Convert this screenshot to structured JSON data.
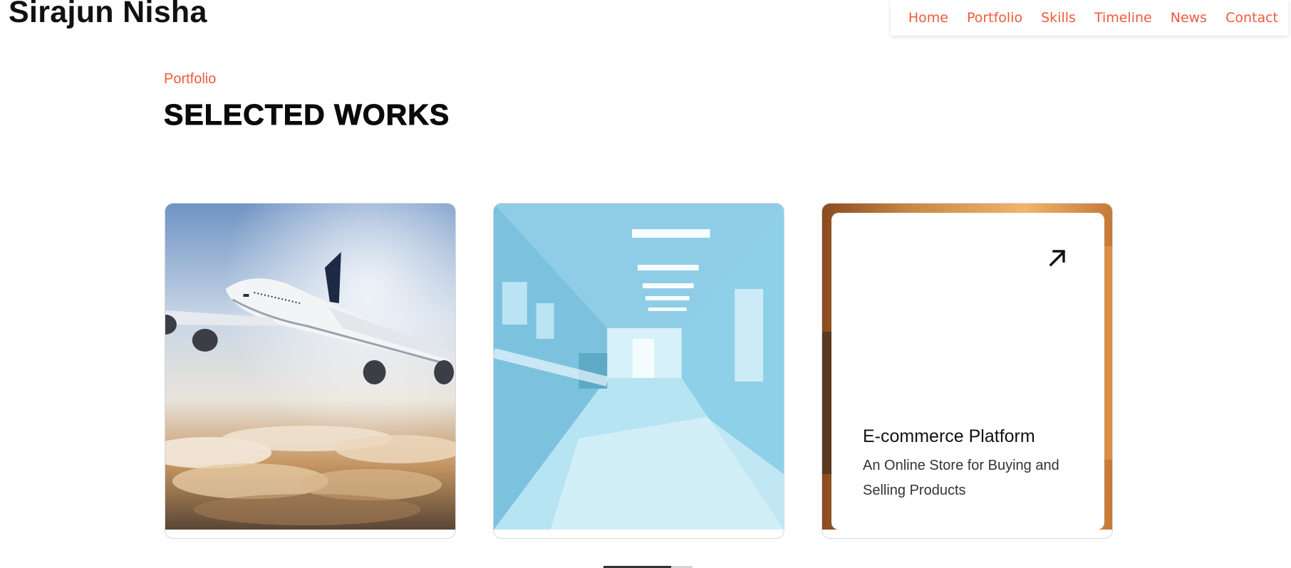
{
  "brand": "Sirajun Nisha",
  "nav": {
    "items": [
      "Home",
      "Portfolio",
      "Skills",
      "Timeline",
      "News",
      "Contact"
    ]
  },
  "colors": {
    "accent": "#f05a3a",
    "text": "#111111"
  },
  "section": {
    "eyebrow": "Portfolio",
    "title": "SELECTED WORKS"
  },
  "cards": [
    {
      "image": "airplane-above-clouds"
    },
    {
      "image": "hospital-corridor"
    },
    {
      "image": "warm-interior",
      "icon": "arrow-up-right-icon",
      "title": "E-commerce Platform",
      "description": "An Online Store for Buying and Selling Products"
    }
  ],
  "carousel": {
    "progress": 0.76
  }
}
